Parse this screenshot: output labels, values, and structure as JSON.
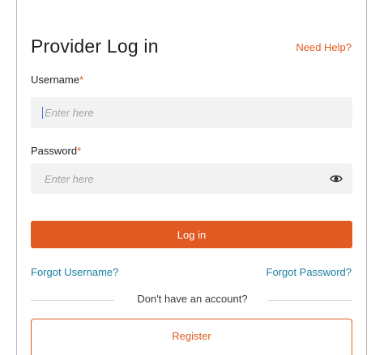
{
  "header": {
    "title": "Provider Log in",
    "help_link": "Need Help?"
  },
  "username": {
    "label": "Username",
    "required_marker": "*",
    "placeholder": "Enter here",
    "value": ""
  },
  "password": {
    "label": "Password",
    "required_marker": "*",
    "placeholder": "Enter here",
    "value": "",
    "toggle_icon": "eye-icon"
  },
  "actions": {
    "login_label": "Log in",
    "forgot_username": "Forgot Username?",
    "forgot_password": "Forgot Password?",
    "divider_text": "Don't have an account?",
    "register_label": "Register"
  },
  "colors": {
    "accent": "#e05a22",
    "link": "#1a7fa3",
    "field_bg": "#f2f2f2"
  }
}
